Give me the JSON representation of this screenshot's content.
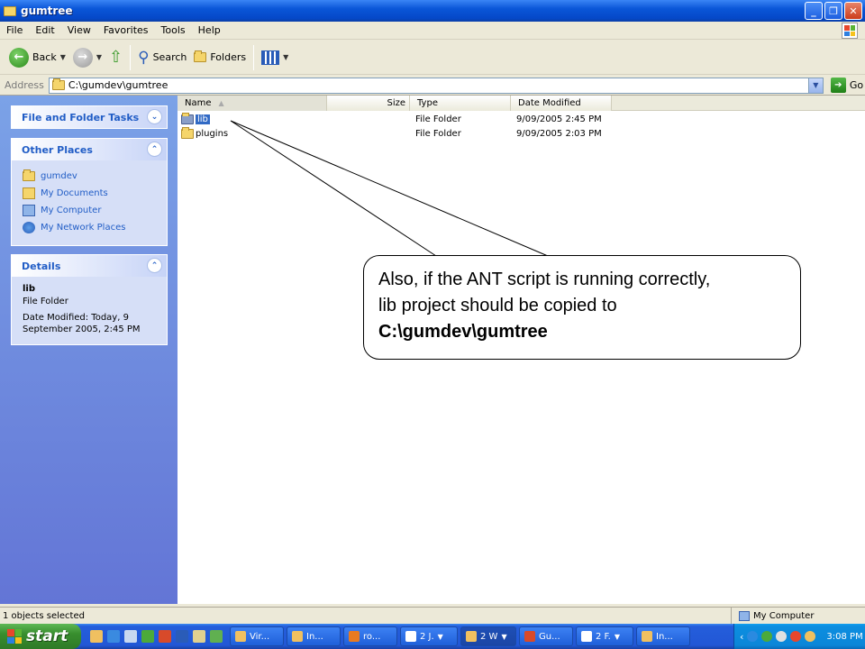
{
  "window": {
    "title": "gumtree"
  },
  "menu": [
    "File",
    "Edit",
    "View",
    "Favorites",
    "Tools",
    "Help"
  ],
  "toolbar": {
    "back": "Back",
    "search": "Search",
    "folders": "Folders"
  },
  "address": {
    "label": "Address",
    "value": "C:\\gumdev\\gumtree",
    "go": "Go"
  },
  "tasks_panel": {
    "title": "File and Folder Tasks"
  },
  "other_places": {
    "title": "Other Places",
    "items": [
      "gumdev",
      "My Documents",
      "My Computer",
      "My Network Places"
    ]
  },
  "details": {
    "title": "Details",
    "name": "lib",
    "type": "File Folder",
    "modified_line1": "Date Modified: Today, 9",
    "modified_line2": "September 2005, 2:45 PM"
  },
  "columns": {
    "name": "Name",
    "size": "Size",
    "type": "Type",
    "date": "Date Modified"
  },
  "files": [
    {
      "name": "lib",
      "size": "",
      "type": "File Folder",
      "date": "9/09/2005 2:45 PM",
      "selected": true
    },
    {
      "name": "plugins",
      "size": "",
      "type": "File Folder",
      "date": "9/09/2005 2:03 PM",
      "selected": false
    }
  ],
  "callout": {
    "line1": "Also, if the ANT script is running correctly,",
    "line2": "lib project should be copied to",
    "line3": "C:\\gumdev\\gumtree"
  },
  "status": {
    "left": "1 objects selected",
    "right": "My Computer"
  },
  "taskbar": {
    "start": "start",
    "tasks": [
      "Vir...",
      "In...",
      "ro...",
      "2 J.",
      "2 W",
      "Gu...",
      "2 F.",
      "In..."
    ],
    "clock": "3:08 PM"
  }
}
